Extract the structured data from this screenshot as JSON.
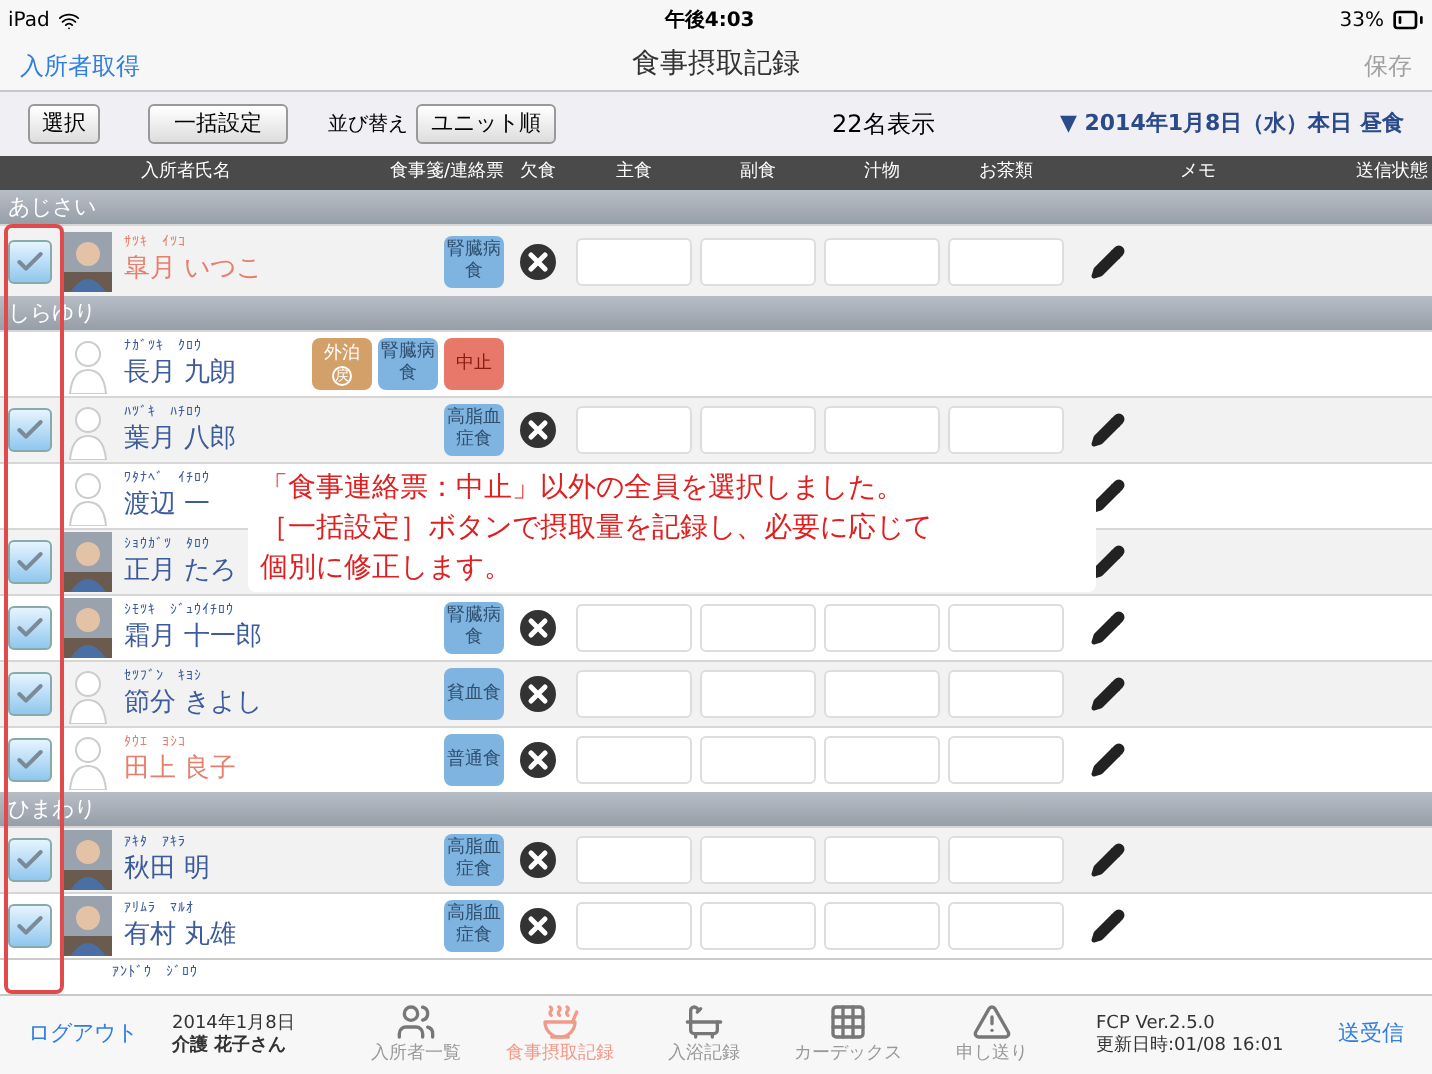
{
  "status_bar": {
    "device": "iPad",
    "time": "午後4:03",
    "battery": "33%"
  },
  "nav": {
    "left": "入所者取得",
    "title": "食事摂取記録",
    "right": "保存",
    "right_disabled": true
  },
  "toolbar": {
    "select": "選択",
    "bulk": "一括設定",
    "sort_label": "並び替え",
    "sort": "ユニット順",
    "count": "22名表示",
    "date": "▼ 2014年1月8日（水）本日 昼食"
  },
  "columns": [
    "入所者氏名",
    "食事箋/連絡票",
    "欠食",
    "主食",
    "副食",
    "汁物",
    "お茶類",
    "メモ",
    "送信状態"
  ],
  "groups": [
    {
      "name": "あじさい",
      "rows": [
        {
          "kind": "record",
          "checked": true,
          "has_photo": true,
          "kana": "ｻﾂｷ　ｲﾂｺ",
          "name": "皐月 いつこ",
          "color": "#e6806e",
          "badges": [
            {
              "kind": "diet",
              "text": "腎臓病食"
            }
          ]
        }
      ]
    },
    {
      "name": "しらゆり",
      "rows": [
        {
          "kind": "stopped",
          "checked": false,
          "has_photo": false,
          "kana": "ﾅｶﾞﾂｷ　ｸﾛｳ",
          "name": "長月 九朗",
          "color": "#3b5b9c",
          "badges": [
            {
              "kind": "outing",
              "text": "外泊",
              "sub": "戻"
            },
            {
              "kind": "diet",
              "text": "腎臓病食"
            },
            {
              "kind": "stop",
              "text": "中止"
            }
          ]
        },
        {
          "kind": "record",
          "checked": true,
          "has_photo": false,
          "kana": "ﾊﾂﾞｷ　ﾊﾁﾛｳ",
          "name": "葉月 八郎",
          "color": "#3b5b9c",
          "badges": [
            {
              "kind": "diet",
              "text": "高脂血症食"
            }
          ]
        },
        {
          "kind": "covered",
          "checked": false,
          "has_photo": false,
          "kana": "ﾜﾀﾅﾍﾞ　ｲﾁﾛｳ",
          "name": "渡辺 一",
          "color": "#3b5b9c",
          "badges": []
        },
        {
          "kind": "covered",
          "checked": true,
          "has_photo": true,
          "kana": "ｼｮｳｶﾞﾂ　ﾀﾛｳ",
          "name": "正月 たろ",
          "color": "#3b5b9c",
          "badges": []
        },
        {
          "kind": "record",
          "checked": true,
          "has_photo": true,
          "kana": "ｼﾓﾂｷ　ｼﾞｭｳｲﾁﾛｳ",
          "name": "霜月 十一郎",
          "color": "#3b5b9c",
          "badges": [
            {
              "kind": "diet",
              "text": "腎臓病食"
            }
          ]
        },
        {
          "kind": "record",
          "checked": true,
          "has_photo": false,
          "kana": "ｾﾂﾌﾞﾝ　ｷﾖｼ",
          "name": "節分 きよし",
          "color": "#3b5b9c",
          "badges": [
            {
              "kind": "diet",
              "text": "貧血食"
            }
          ]
        },
        {
          "kind": "record",
          "checked": true,
          "has_photo": false,
          "kana": "ﾀｳｴ　ﾖｼｺ",
          "name": "田上 良子",
          "color": "#e6806e",
          "badges": [
            {
              "kind": "diet",
              "text": "普通食"
            }
          ]
        }
      ]
    },
    {
      "name": "ひまわり",
      "rows": [
        {
          "kind": "record",
          "checked": true,
          "has_photo": true,
          "kana": "ｱｷﾀ　ｱｷﾗ",
          "name": "秋田 明",
          "color": "#3b5b9c",
          "badges": [
            {
              "kind": "diet",
              "text": "高脂血症食"
            }
          ]
        },
        {
          "kind": "record",
          "checked": true,
          "has_photo": true,
          "kana": "ｱﾘﾑﾗ　ﾏﾙｵ",
          "name": "有村 丸雄",
          "color": "#3b5b9c",
          "badges": [
            {
              "kind": "diet",
              "text": "高脂血症食"
            }
          ]
        },
        {
          "kind": "partial",
          "kana": "ｱﾝﾄﾞｳ　ｼﾞﾛｳ",
          "color": "#3b5b9c"
        }
      ]
    }
  ],
  "callout": {
    "lines": [
      "「食事連絡票：中止」以外の全員を選択しました。",
      "［一括設定］ボタンで摂取量を記録し、必要に応じて",
      "個別に修正します。"
    ]
  },
  "footer": {
    "logout": "ログアウト",
    "date": "2014年1月8日",
    "user": "介護 花子さん",
    "tabs": [
      {
        "label": "入所者一覧",
        "selected": false
      },
      {
        "label": "食事摂取記録",
        "selected": true
      },
      {
        "label": "入浴記録",
        "selected": false
      },
      {
        "label": "カーデックス",
        "selected": false
      },
      {
        "label": "申し送り",
        "selected": false
      }
    ],
    "version": "FCP Ver.2.5.0",
    "updated": "更新日時:01/08 16:01",
    "sync": "送受信"
  }
}
